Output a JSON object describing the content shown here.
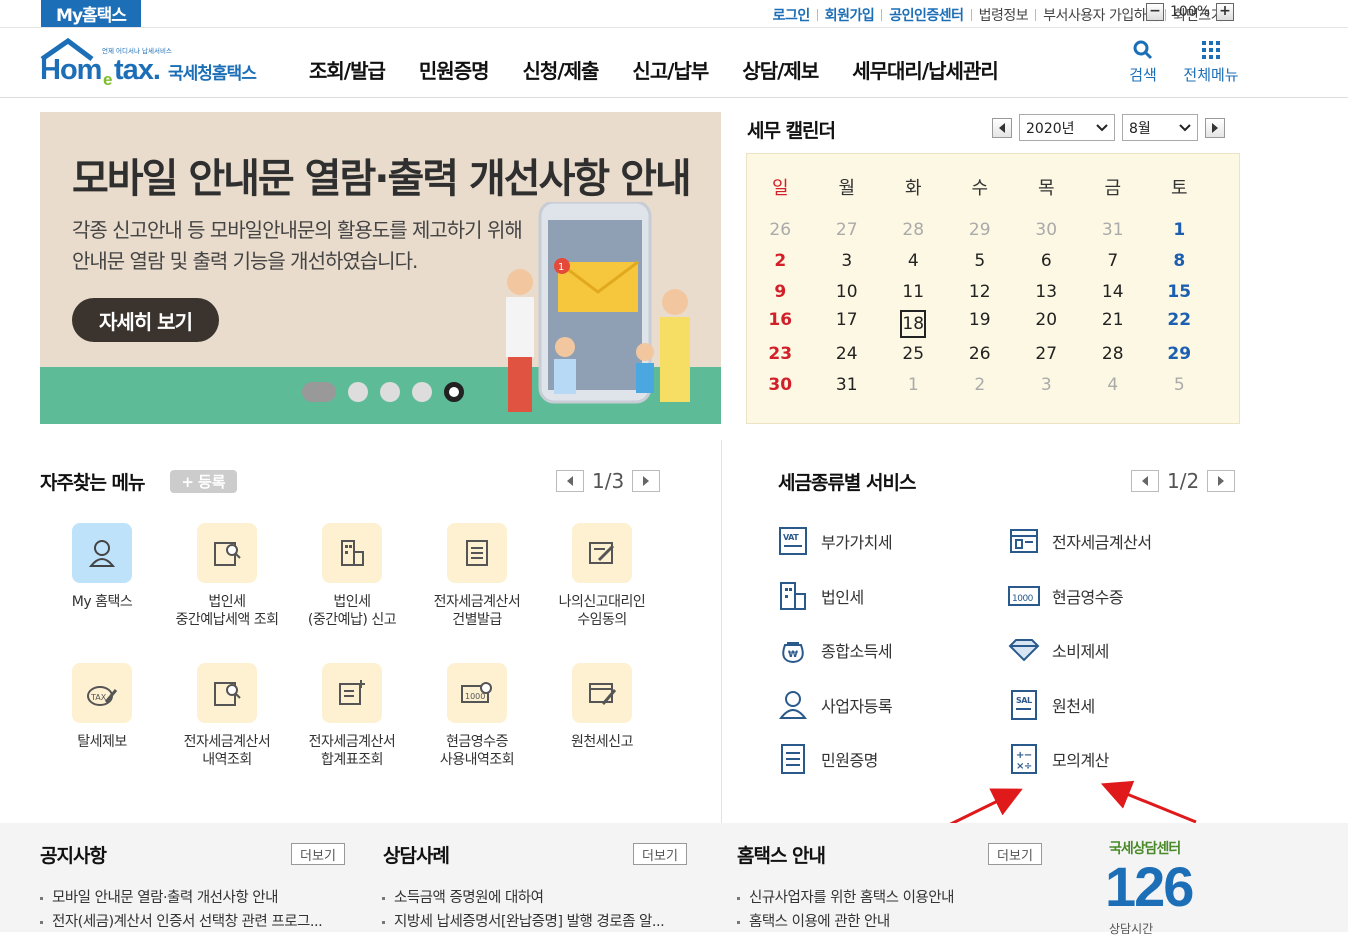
{
  "topbar": {
    "my_hometax": "My홈택스",
    "links": [
      "로그인",
      "회원가입",
      "공인인증센터",
      "법령정보",
      "부서사용자 가입하기",
      "화면크기"
    ],
    "zoom_value": "100%",
    "zoom_minus": "−",
    "zoom_plus": "+"
  },
  "header": {
    "logo_small": "언제 어디서나 납세서비스",
    "logo_main": "Hometax.",
    "logo_kr": "국세청홈택스",
    "nav": [
      "조회/발급",
      "민원증명",
      "신청/제출",
      "신고/납부",
      "상담/제보",
      "세무대리/납세관리"
    ],
    "search_label": "검색",
    "menu_label": "전체메뉴"
  },
  "banner": {
    "title": "모바일 안내문 열람·출력 개선사항 안내",
    "desc1": "각종 신고안내 등 모바일안내문의 활용도를 제고하기 위해",
    "desc2": "안내문 열람 및 출력 기능을 개선하였습니다.",
    "button": "자세히 보기",
    "badge": "1"
  },
  "calendar": {
    "title": "세무 캘린더",
    "year": "2020년",
    "month": "8월",
    "weekdays": [
      "일",
      "월",
      "화",
      "수",
      "목",
      "금",
      "토"
    ],
    "weeks": [
      [
        "26",
        "27",
        "28",
        "29",
        "30",
        "31",
        "1"
      ],
      [
        "2",
        "3",
        "4",
        "5",
        "6",
        "7",
        "8"
      ],
      [
        "9",
        "10",
        "11",
        "12",
        "13",
        "14",
        "15"
      ],
      [
        "16",
        "17",
        "18",
        "19",
        "20",
        "21",
        "22"
      ],
      [
        "23",
        "24",
        "25",
        "26",
        "27",
        "28",
        "29"
      ],
      [
        "30",
        "31",
        "1",
        "2",
        "3",
        "4",
        "5"
      ]
    ],
    "today": "18"
  },
  "favorites": {
    "title": "자주찾는 메뉴",
    "register": "등록",
    "page": "1/3",
    "items": [
      {
        "label": "My 홈택스",
        "icon": "person-icon"
      },
      {
        "label": "법인세\n중간예납세액 조회",
        "icon": "document-search-icon"
      },
      {
        "label": "법인세\n(중간예납) 신고",
        "icon": "building-icon"
      },
      {
        "label": "전자세금계산서\n건별발급",
        "icon": "invoice-icon"
      },
      {
        "label": "나의신고대리인\n수임동의",
        "icon": "signature-icon"
      },
      {
        "label": "탈세제보",
        "icon": "tax-bag-icon"
      },
      {
        "label": "전자세금계산서\n내역조회",
        "icon": "document-search-icon"
      },
      {
        "label": "전자세금계산서\n합계표조회",
        "icon": "document-plus-icon"
      },
      {
        "label": "현금영수증\n사용내역조회",
        "icon": "cash-receipt-icon"
      },
      {
        "label": "원천세신고",
        "icon": "calendar-pen-icon"
      }
    ]
  },
  "tax_services": {
    "title": "세금종류별 서비스",
    "page": "1/2",
    "items": [
      {
        "label": "부가가치세",
        "icon": "vat-icon"
      },
      {
        "label": "전자세금계산서",
        "icon": "e-invoice-icon"
      },
      {
        "label": "법인세",
        "icon": "corporate-icon"
      },
      {
        "label": "현금영수증",
        "icon": "cash-1000-icon"
      },
      {
        "label": "종합소득세",
        "icon": "money-bag-icon"
      },
      {
        "label": "소비제세",
        "icon": "diamond-icon"
      },
      {
        "label": "사업자등록",
        "icon": "person-register-icon"
      },
      {
        "label": "원천세",
        "icon": "sal-document-icon"
      },
      {
        "label": "민원증명",
        "icon": "certificate-icon"
      },
      {
        "label": "모의계산",
        "icon": "calculator-icon"
      }
    ]
  },
  "bottom": {
    "notice_title": "공지사항",
    "notice_items": [
      "모바일 안내문 열람·출력 개선사항 안내",
      "전자(세금)계산서 인증서 선택창 관련 프로그..."
    ],
    "consult_title": "상담사례",
    "consult_items": [
      "소득금액 증명원에 대하여",
      "지방세 납세증명서[완납증명] 발행 경로좀 알..."
    ],
    "guide_title": "홈택스 안내",
    "guide_items": [
      "신규사업자를 위한 홈택스 이용안내",
      "홈택스 이용에 관한 안내"
    ],
    "more_label": "더보기",
    "center_title": "국세상담센터",
    "center_number": "126",
    "center_sub": "상담시간"
  },
  "colors": {
    "brand_blue": "#1c6fb7",
    "sunday_red": "#d2202a",
    "saturday_blue": "#1c5fb0",
    "annotation_red": "#e01a1a"
  }
}
